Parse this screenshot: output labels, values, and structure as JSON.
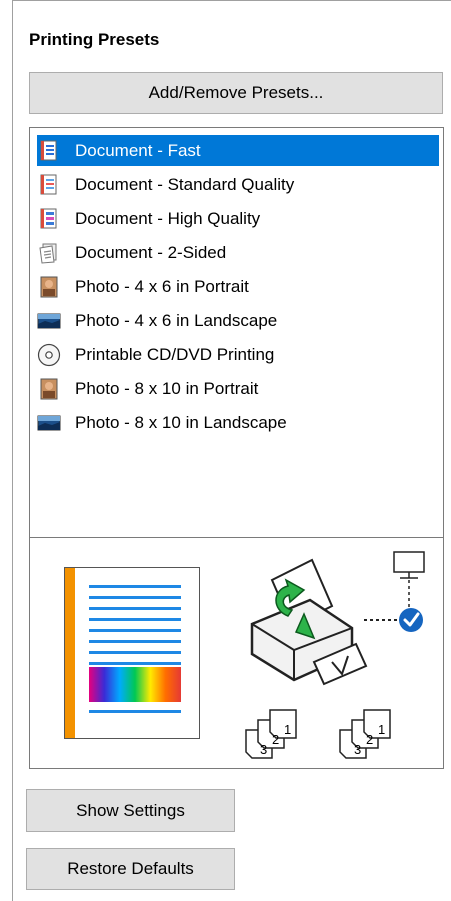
{
  "panel": {
    "title": "Printing Presets"
  },
  "buttons": {
    "add_remove": "Add/Remove Presets...",
    "show_settings": "Show Settings",
    "restore_defaults": "Restore Defaults"
  },
  "presets": [
    {
      "label": "Document - Fast",
      "icon": "document-fast-icon",
      "selected": true
    },
    {
      "label": "Document - Standard Quality",
      "icon": "document-standard-icon",
      "selected": false
    },
    {
      "label": "Document - High Quality",
      "icon": "document-high-quality-icon",
      "selected": false
    },
    {
      "label": "Document - 2-Sided",
      "icon": "document-2-sided-icon",
      "selected": false
    },
    {
      "label": "Photo - 4 x 6 in Portrait",
      "icon": "photo-portrait-icon",
      "selected": false
    },
    {
      "label": "Photo - 4 x 6 in Landscape",
      "icon": "photo-landscape-icon",
      "selected": false
    },
    {
      "label": "Printable CD/DVD Printing",
      "icon": "cd-dvd-icon",
      "selected": false
    },
    {
      "label": "Photo - 8 x 10 in Portrait",
      "icon": "photo-portrait-icon",
      "selected": false
    },
    {
      "label": "Photo - 8 x 10 in Landscape",
      "icon": "photo-landscape-icon",
      "selected": false
    }
  ],
  "preview": {
    "page_order_labels": [
      "1",
      "2",
      "3"
    ]
  },
  "colors": {
    "selection": "#0078d7",
    "accent_orange": "#f39200",
    "line_blue": "#1e88e5",
    "check_blue": "#1565c0",
    "arrow_green": "#2db34a"
  }
}
